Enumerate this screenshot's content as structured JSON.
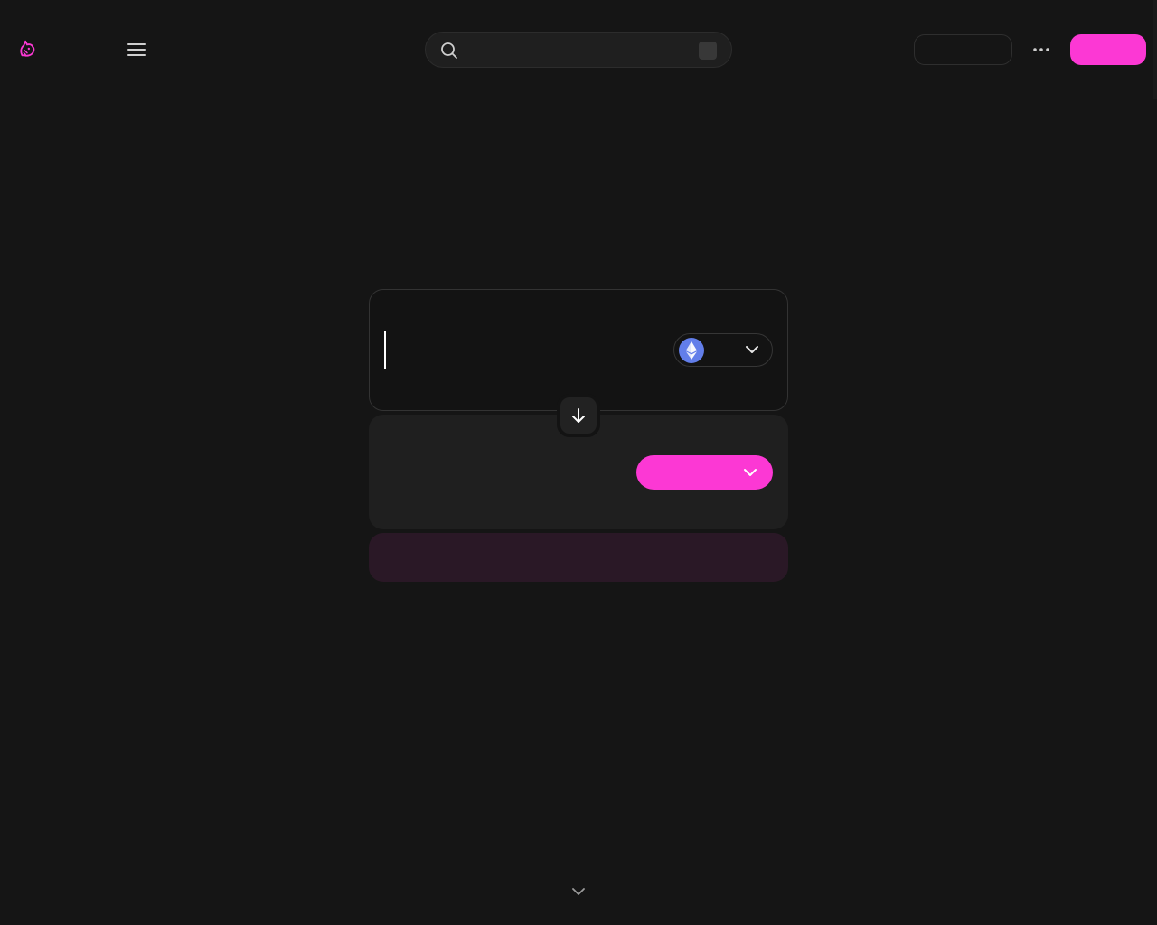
{
  "nav": {
    "logo_icon": "uniswap-unicorn-icon",
    "menu_icon": "hamburger-menu-icon",
    "search": {
      "icon": "search-icon",
      "placeholder": "",
      "shortcut_key": ""
    },
    "get_app_label": "",
    "more_icon": "ellipsis-icon",
    "connect_label": ""
  },
  "swap": {
    "sell": {
      "label": "",
      "amount": "",
      "token_symbol": "",
      "token_icon": "ethereum-icon",
      "chevron_icon": "chevron-down-icon"
    },
    "switch_icon": "arrow-down-icon",
    "buy": {
      "label": "",
      "amount": "",
      "select_token_label": "",
      "chevron_icon": "chevron-down-icon"
    },
    "action_label": ""
  },
  "footer": {
    "scroll_icon": "chevron-down-icon"
  },
  "colors": {
    "background": "#151515",
    "accent_pink": "#fc38d4",
    "panel_dark": "#131313",
    "panel_gray": "#1f1f1f",
    "action_bg": "#2a1826",
    "ethereum_blue": "#627eea"
  }
}
